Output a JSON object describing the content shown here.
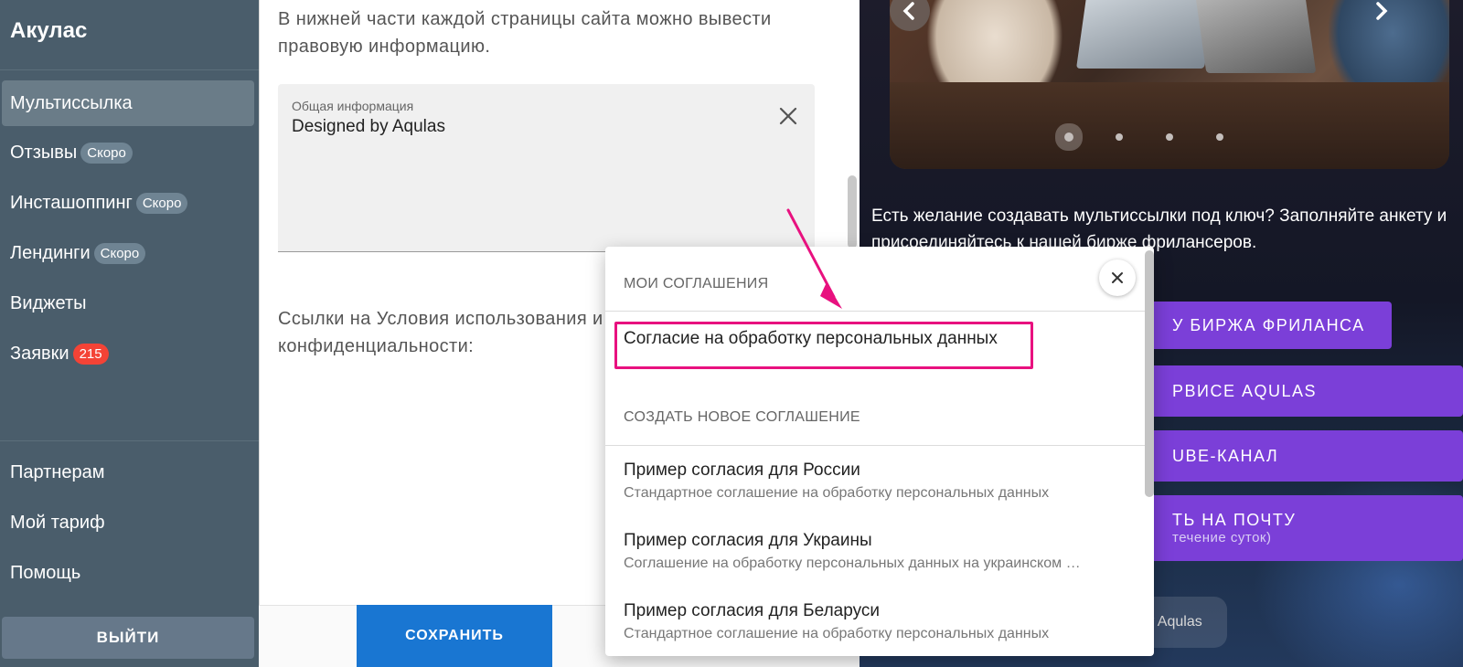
{
  "sidebar": {
    "brand": "Акулас",
    "items": [
      {
        "label": "Мультиссылка",
        "badge": ""
      },
      {
        "label": "Отзывы",
        "badge": "Скоро"
      },
      {
        "label": "Инсташоппинг",
        "badge": "Скоро"
      },
      {
        "label": "Лендинги",
        "badge": "Скоро"
      },
      {
        "label": "Виджеты",
        "badge": ""
      },
      {
        "label": "Заявки",
        "badge": "215"
      }
    ],
    "bottom_items": [
      {
        "label": "Партнерам"
      },
      {
        "label": "Мой тариф"
      },
      {
        "label": "Помощь"
      }
    ],
    "logout_label": "ВЫЙТИ"
  },
  "editor": {
    "intro": "В нижней части каждой страницы сайта можно вывести правовую информацию.",
    "field_label": "Общая информация",
    "field_value": "Designed by Aqulas",
    "links_text": "Ссылки на Условия использования и Политику конфиденциальности:",
    "save_label": "СОХРАНИТЬ"
  },
  "dropdown": {
    "heading_my": "МОИ СОГЛАШЕНИЯ",
    "my_items": [
      "Согласие на обработку персональных данных"
    ],
    "heading_new": "СОЗДАТЬ НОВОЕ СОГЛАШЕНИЕ",
    "templates": [
      {
        "title": "Пример согласия для России",
        "subtitle": "Стандартное соглашение на обработку персональных данных"
      },
      {
        "title": "Пример согласия для Украины",
        "subtitle": "Соглашение на обработку персональных данных на украинском …"
      },
      {
        "title": "Пример согласия для Беларуси",
        "subtitle": "Стандартное соглашение на обработку персональных данных"
      }
    ]
  },
  "preview": {
    "promo": "Есть желание создавать мультиссылки под ключ? Заполняйте анкету и присоединяйтесь к нашей бирже фрилансеров.",
    "buttons": [
      {
        "label": "У БИРЖА ФРИЛАНСА",
        "sub": ""
      },
      {
        "label": "РВИСЕ AQULAS",
        "sub": ""
      },
      {
        "label": "UBE-КАНАЛ",
        "sub": ""
      },
      {
        "label": "ТЬ НА ПОЧТУ",
        "sub": "течение суток)"
      }
    ],
    "made_by": "d by Aqulas",
    "carousel_total": 4,
    "carousel_active": 1
  },
  "colors": {
    "sidebar_bg": "#4a5d6b",
    "accent_blue": "#1976d2",
    "purple": "#7b3fd8",
    "highlight_pink": "#e8117f",
    "badge_red": "#f44336"
  }
}
